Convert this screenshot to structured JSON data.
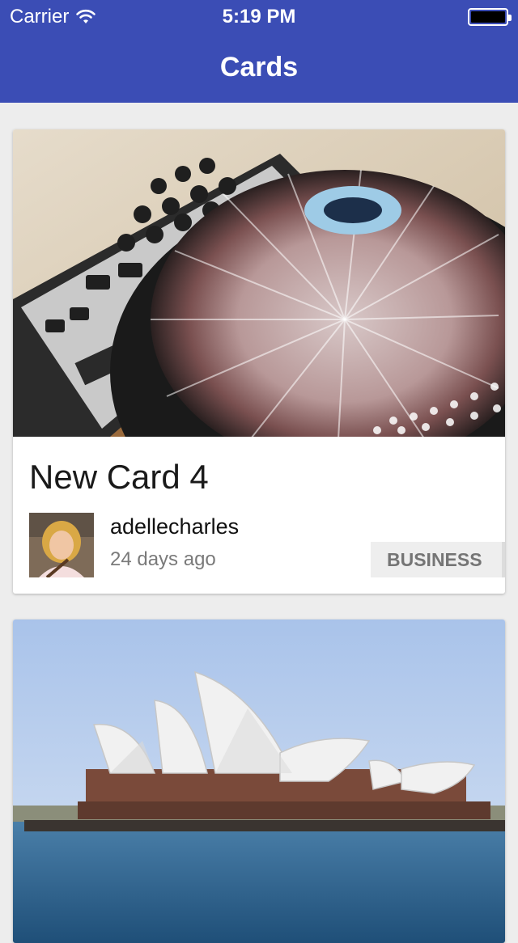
{
  "status_bar": {
    "carrier": "Carrier",
    "time": "5:19 PM"
  },
  "nav": {
    "title": "Cards",
    "accent_color": "#3b4db5"
  },
  "cards": [
    {
      "title": "New Card 4",
      "author": "adellecharles",
      "time_ago": "24 days ago",
      "category": "BUSINESS",
      "image": "dj-turntable-photo"
    },
    {
      "image": "sydney-opera-house-photo"
    }
  ]
}
